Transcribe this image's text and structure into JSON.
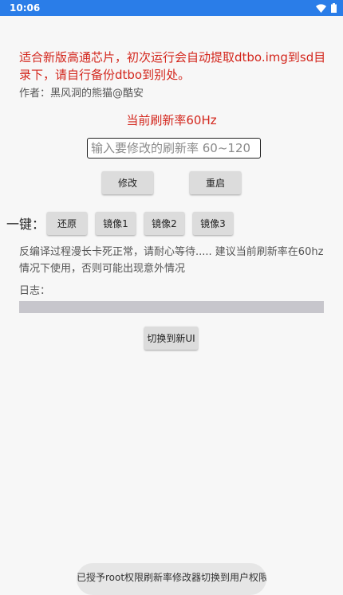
{
  "status": {
    "time": "10:06",
    "icons": [
      "wifi-icon",
      "battery-icon"
    ]
  },
  "warning_text": "适合新版高通芯片，初次运行会自动提取dtbo.img到sd目录下，请自行备份dtbo到别处。",
  "author": "作者：黑风洞的熊猫@酷安",
  "current_rate": "当前刷新率60Hz",
  "rate_input": {
    "placeholder": "输入要修改的刷新率 60~120",
    "value": ""
  },
  "buttons": {
    "modify": "修改",
    "restart": "重启",
    "restore": "还原",
    "image1": "镜像1",
    "image2": "镜像2",
    "image3": "镜像3",
    "switch_ui": "切换到新UI"
  },
  "onekey_label": "一键：",
  "note": "反编译过程漫长卡死正常，请耐心等待..... 建议当前刷新率在60hz情况下使用，否则可能出现意外情况",
  "log_label": "日志：",
  "toast": "已授予root权限刷新率修改器切换到用户权限"
}
